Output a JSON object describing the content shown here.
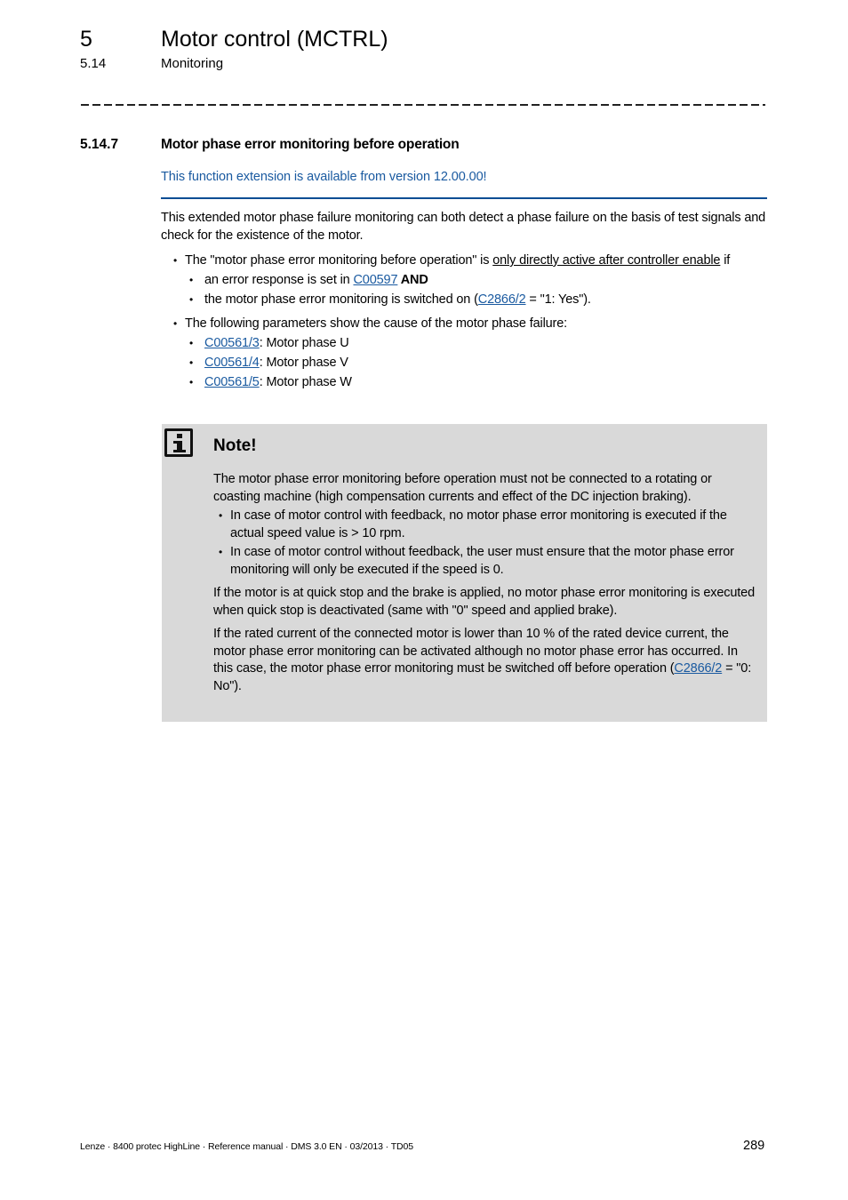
{
  "header": {
    "chapter_number": "5",
    "chapter_title": "Motor control (MCTRL)",
    "section_number": "5.14",
    "section_title": "Monitoring"
  },
  "subsection": {
    "number": "5.14.7",
    "title": "Motor phase error monitoring before operation",
    "version_note": "This function extension is available from version 12.00.00!"
  },
  "intro": "This extended motor phase failure monitoring can both detect a phase failure on the basis of test signals and check for the existence of the motor.",
  "bullets": {
    "b1": {
      "pre": "The \"motor phase error monitoring before operation\" is ",
      "underlined": "only directly active after controller enable",
      "post": " if",
      "sub1": {
        "pre": "an error response is set in ",
        "link": "C00597",
        "bold": " AND"
      },
      "sub2": {
        "pre": "the motor phase error monitoring is switched on (",
        "link": "C2866/2",
        "post": " = \"1: Yes\")."
      }
    },
    "b2": {
      "text": "The following parameters show the cause of the motor phase failure:",
      "params": [
        {
          "link": "C00561/3",
          "desc": ": Motor phase U"
        },
        {
          "link": "C00561/4",
          "desc": ": Motor phase V"
        },
        {
          "link": "C00561/5",
          "desc": ": Motor phase W"
        }
      ]
    }
  },
  "note": {
    "icon": "info-icon",
    "heading": "Note!",
    "para1": "The motor phase error monitoring before operation must not be connected to a rotating or coasting machine (high compensation currents and effect of the DC injection braking).",
    "bullet1": "In case of motor control with feedback, no motor phase error monitoring is executed if the actual speed value is > 10 rpm.",
    "bullet2": "In case of motor control without feedback, the user must ensure that the motor phase error monitoring will only be executed if the speed is 0.",
    "para2": "If the motor is at quick stop and the brake is applied, no motor phase error monitoring is executed when quick stop is deactivated (same with \"0\" speed and applied brake).",
    "para3_pre": "If the rated current of the connected motor is lower than 10 % of the rated device current, the motor phase error monitoring can be activated although no motor phase error has occurred. In this case, the motor phase error monitoring must be switched off before operation (",
    "para3_link": "C2866/2",
    "para3_post": " = \"0: No\")."
  },
  "footer": {
    "text": "Lenze · 8400 protec HighLine · Reference manual · DMS 3.0 EN · 03/2013 · TD05",
    "page_number": "289"
  },
  "colors": {
    "link": "#1a5aa0",
    "rule": "#0a4d94",
    "note_bg": "#d9d9d9"
  }
}
